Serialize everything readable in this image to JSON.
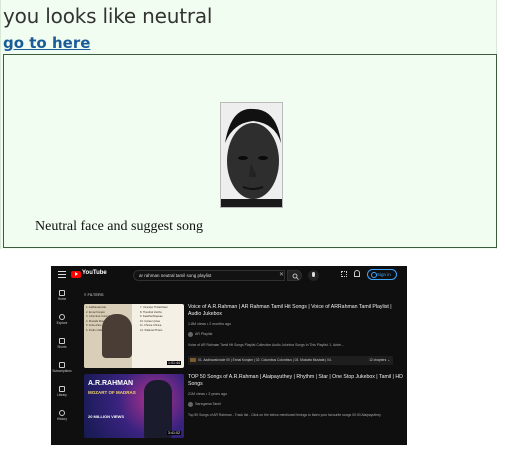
{
  "page": {
    "heading": "you looks like neutral",
    "link_text": "go to here",
    "caption": "Neutral face and suggest song"
  },
  "youtube": {
    "logo_text": "YouTube",
    "search_query": "ar rahman neutral tamil song playlist",
    "signin_label": "Sign in",
    "filters_label": "FILTERS",
    "sidebar": [
      {
        "label": "Home",
        "icon": "home-icon"
      },
      {
        "label": "Explore",
        "icon": "compass-icon"
      },
      {
        "label": "Shorts",
        "icon": "shorts-icon"
      },
      {
        "label": "Subscriptions",
        "icon": "subscriptions-icon"
      },
      {
        "label": "Library",
        "icon": "library-icon"
      },
      {
        "label": "History",
        "icon": "history-icon"
      }
    ],
    "results": [
      {
        "title": "Voice of A.R.Rahman | AR Rahman Tamil Hit Songs | Voice of ARRahman Tamil Playlist | Audio Jukebox",
        "meta": "1.8M views • 2 months ago",
        "channel": "AR Playlist",
        "description": "Voice of AR Rahman Tamil Hit Songs Playlist Collection Audio Jukebox Songs In This Playlist: 1. Anbe...",
        "chapters": "01. Aadhavaknode 00 | Ennai Konjam | 02. Columbus Columbus | 03. Mustafa Mustafa | 04.",
        "chapters_more": "12 chapters ⌄",
        "duration": "1:01:44",
        "thumb_list": [
          "1. Aadhavaknode",
          "2. Ennai Konjam",
          "3. Columbus Columbus",
          "4. Mustafa Mustafa",
          "5. Anbe Anbe",
          "6. Pudhu Vellai Mazhai",
          "7. Usuraiye Tholaichaen",
          "8. Thendral Vanthu",
          "9. Kaadhal Rojavae",
          "10. Uyirae Uyirae",
          "11. Chinna Chinna",
          "12. Sollamal Thottu"
        ]
      },
      {
        "title": "TOP 50 Songs of A.R.Rahman | Alaipayuthey | Rhythm | Star | One Stop Jukebox | Tamil | HD Songs",
        "meta": "21M views • 3 years ago",
        "channel": "Saregama Tamil",
        "description": "Top 50 Songs of AR Rahman - Track list - Click on the below mentioned timings to listen your favourite songs 00:00 Alaipayuthey",
        "duration": "3:41:02",
        "thumb_title": "A.R.RAHMAN",
        "thumb_subtitle": "MOZART OF MADRAS",
        "thumb_tag": "20 MILLION VIEWS"
      }
    ]
  },
  "colors": {
    "page_bg": "#f2fdf1",
    "link": "#1a5b9a",
    "youtube_bg": "#0f0f0f",
    "youtube_red": "#ff0000",
    "signin_blue": "#3ea6ff"
  }
}
